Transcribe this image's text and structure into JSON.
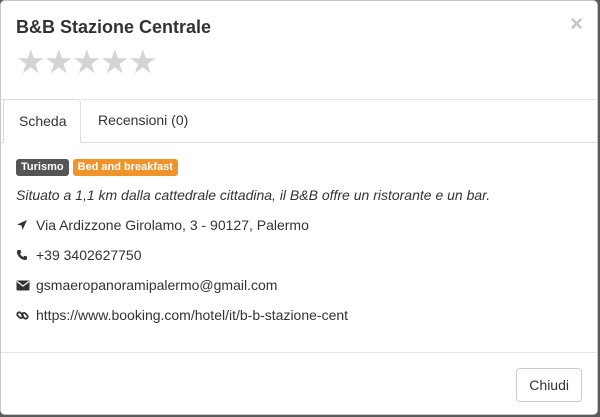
{
  "modal": {
    "title": "B&B Stazione Centrale",
    "close_symbol": "×",
    "rating": {
      "value": 0,
      "max": 5,
      "star_glyph": "★"
    }
  },
  "tabs": [
    {
      "label": "Scheda",
      "active": true
    },
    {
      "label": "Recensioni (0)",
      "active": false
    }
  ],
  "details": {
    "tags": [
      {
        "label": "Turismo",
        "color": "#555555"
      },
      {
        "label": "Bed and breakfast",
        "color": "#f0932b"
      }
    ],
    "description": "Situato a 1,1 km dalla cattedrale cittadina, il B&B offre un ristorante e un bar.",
    "address": "Via Ardizzone Girolamo, 3 - 90127, Palermo",
    "phone": "+39 3402627750",
    "email": "gsmaeropanoramipalermo@gmail.com",
    "website": "https://www.booking.com/hotel/it/b-b-stazione-cent",
    "icons": {
      "address": "location-arrow-icon",
      "phone": "phone-icon",
      "email": "envelope-icon",
      "website": "link-icon"
    }
  },
  "footer": {
    "close_label": "Chiudi"
  }
}
